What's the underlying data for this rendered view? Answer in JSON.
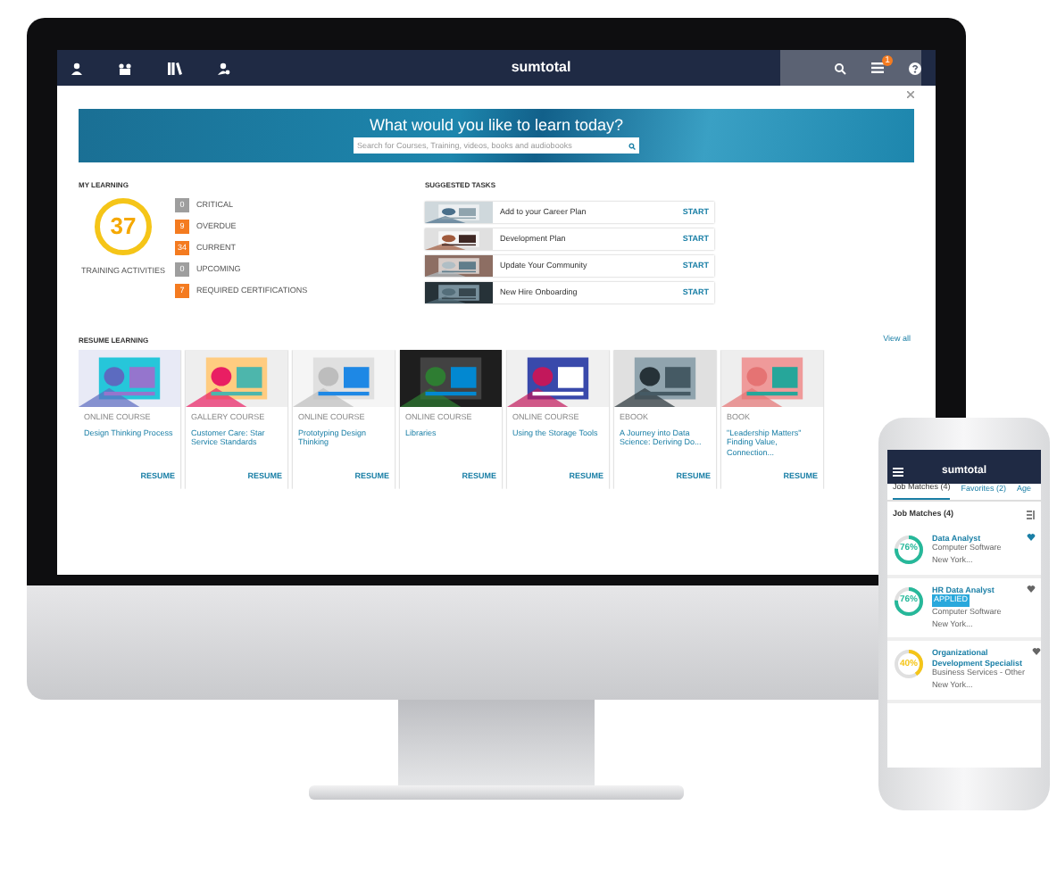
{
  "header": {
    "logo": "sumtotal",
    "alert_count": "1"
  },
  "banner": {
    "title": "What would you like to learn today?",
    "search": {
      "placeholder": "Search for Courses, Training, videos, books and audiobooks"
    }
  },
  "my_learning": {
    "title": "MY LEARNING",
    "total": "37",
    "total_label": "TRAINING ACTIVITIES",
    "statuses": [
      {
        "count": "0",
        "label": "CRITICAL",
        "color": "#9e9e9e"
      },
      {
        "count": "9",
        "label": "OVERDUE",
        "color": "#f47b20"
      },
      {
        "count": "34",
        "label": "CURRENT",
        "color": "#f47b20"
      },
      {
        "count": "0",
        "label": "UPCOMING",
        "color": "#9e9e9e"
      },
      {
        "count": "7",
        "label": "REQUIRED CERTIFICATIONS",
        "color": "#f47b20"
      }
    ]
  },
  "suggested_tasks": {
    "title": "SUGGESTED TASKS",
    "tasks": [
      {
        "label": "Add to your Career Plan",
        "action": "START"
      },
      {
        "label": "Development Plan",
        "action": "START"
      },
      {
        "label": "Update Your Community",
        "action": "START"
      },
      {
        "label": "New Hire Onboarding",
        "action": "START"
      }
    ]
  },
  "resume_learning": {
    "title": "RESUME LEARNING",
    "view_all": "View all",
    "cards": [
      {
        "type": "ONLINE COURSE",
        "title": "Design Thinking Process",
        "action": "RESUME"
      },
      {
        "type": "GALLERY COURSE",
        "title": "Customer Care: Star Service Standards",
        "action": "RESUME"
      },
      {
        "type": "ONLINE COURSE",
        "title": "Prototyping Design Thinking",
        "action": "RESUME"
      },
      {
        "type": "ONLINE COURSE",
        "title": "Libraries",
        "action": "RESUME"
      },
      {
        "type": "ONLINE COURSE",
        "title": "Using the Storage Tools",
        "action": "RESUME"
      },
      {
        "type": "EBOOK",
        "title": "A Journey into Data Science: Deriving Do...",
        "action": "RESUME"
      },
      {
        "type": "BOOK",
        "title": "\"Leadership Matters\" Finding Value, Connection...",
        "action": "RESUME"
      }
    ]
  },
  "phone": {
    "logo": "sumtotal",
    "tabs": [
      {
        "label": "Job Matches (4)",
        "selected": true
      },
      {
        "label": "Favorites (2)",
        "selected": false
      },
      {
        "label": "Age",
        "selected": false
      }
    ],
    "heading": "Job Matches (4)",
    "jobs": [
      {
        "match": "76%",
        "level": 0.76,
        "color": "#26b89a",
        "title": "Data Analyst",
        "company": "Computer Software",
        "location": "New York...",
        "favorite": true
      },
      {
        "match": "76%",
        "level": 0.76,
        "color": "#26b89a",
        "title": "HR Data Analyst",
        "badge": "APPLIED",
        "company": "Computer Software",
        "location": "New York...",
        "favorite": false
      },
      {
        "match": "40%",
        "level": 0.4,
        "color": "#f5c518",
        "title": "Organizational Development Specialist",
        "company": "Business Services - Other",
        "location": "New York...",
        "favorite": false
      }
    ]
  }
}
